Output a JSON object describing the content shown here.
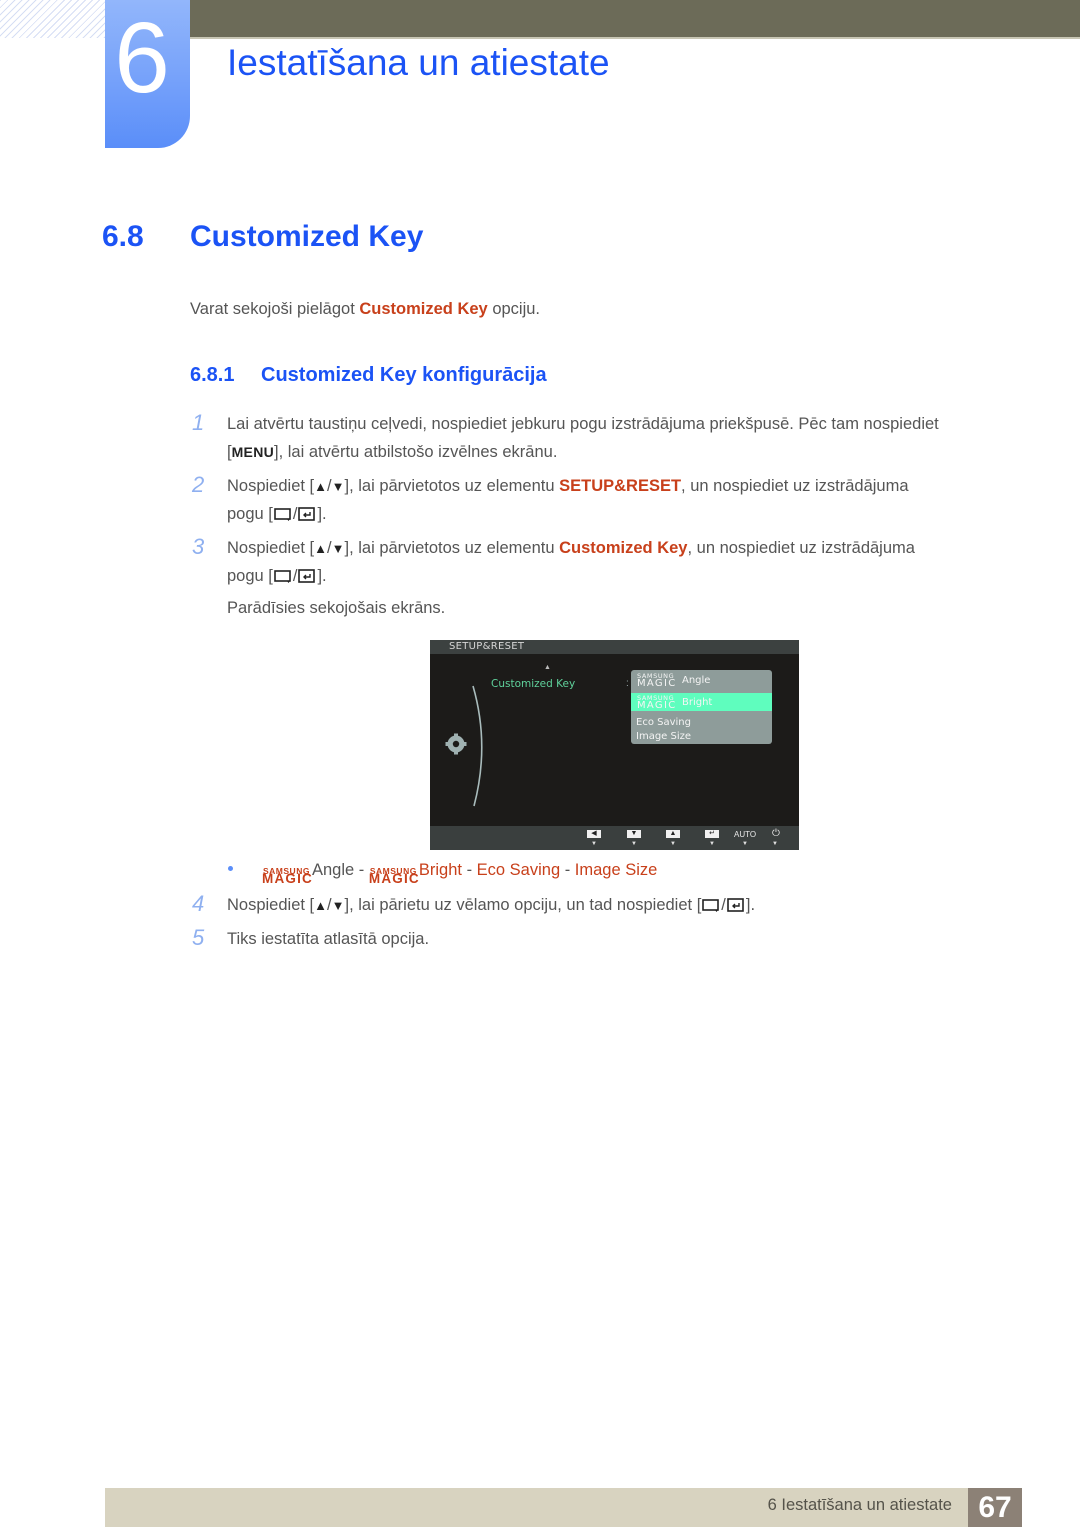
{
  "header": {
    "chapter_number": "6",
    "chapter_title": "Iestatīšana un atiestate"
  },
  "section": {
    "number": "6.8",
    "title": "Customized Key",
    "intro_before": "Varat sekojoši pielāgot ",
    "intro_highlight": "Customized Key",
    "intro_after": " opciju."
  },
  "subsection": {
    "number": "6.8.1",
    "title": "Customized Key konfigurācija"
  },
  "steps": [
    {
      "number": "1",
      "line1": "Lai atvērtu taustiņu ceļvedi, nospiediet jebkuru pogu izstrādājuma priekšpusē. Pēc tam nospiediet",
      "line2_key": "MENU",
      "line2_after": "], lai atvērtu atbilstošo izvēlnes ekrānu."
    },
    {
      "number": "2",
      "before": "Nospiediet [",
      "mid": "], lai pārvietotos uz elementu ",
      "highlight": "SETUP&RESET",
      "after": ", un nospiediet uz izstrādājuma",
      "line2_before": "pogu [",
      "line2_after": "]."
    },
    {
      "number": "3",
      "before": "Nospiediet [",
      "mid": "], lai pārvietotos uz elementu ",
      "highlight": "Customized Key",
      "after": ", un nospiediet uz izstrādājuma",
      "line2_before": "pogu [",
      "line2_after": "].",
      "note": "Parādīsies sekojošais ekrāns."
    },
    {
      "number": "4",
      "before": "Nospiediet [",
      "mid": "], lai pārietu uz vēlamo opciju, un tad nospiediet [",
      "after": "]."
    },
    {
      "number": "5",
      "text": "Tiks iestatīta atlasītā opcija."
    }
  ],
  "symbols": {
    "up": "▲",
    "down": "▼",
    "slash": "/",
    "bracket_open": "[",
    "bracket_close": "]"
  },
  "osd": {
    "title": "SETUP&RESET",
    "up_arrow": "▲",
    "menu_item": "Customized Key",
    "colon": ":",
    "magic_small": "SAMSUNG",
    "magic_big": "MAGIC",
    "options": [
      {
        "label": "Angle",
        "magic": true,
        "selected": false
      },
      {
        "label": "Bright",
        "magic": true,
        "selected": true
      },
      {
        "label": "Eco Saving",
        "magic": false,
        "selected": false
      },
      {
        "label": "Image Size",
        "magic": false,
        "selected": false
      }
    ],
    "buttons": [
      {
        "icon": "left-icon",
        "glyph": "◀"
      },
      {
        "icon": "down-icon",
        "glyph": "▼"
      },
      {
        "icon": "up-icon",
        "glyph": "▲"
      },
      {
        "icon": "enter-icon",
        "glyph": "↵"
      },
      {
        "icon": "auto-label",
        "glyph": "AUTO"
      },
      {
        "icon": "power-icon",
        "glyph": "⏻"
      }
    ],
    "button_hint_arrow": "▼"
  },
  "option_list": {
    "magic_small": "SAMSUNG",
    "magic_big": "MAGIC",
    "angle": "Angle",
    "bright": "Bright",
    "eco": "Eco Saving",
    "image_size": "Image Size",
    "separator": " - "
  },
  "footer": {
    "chapter_label": "6 Iestatīšana un atiestate",
    "page_number": "67"
  },
  "colors": {
    "heading_blue": "#1b53f5",
    "highlight_orange": "#c8401b",
    "osd_selected": "#5ffdbe",
    "osd_text_green": "#5fd19b"
  }
}
